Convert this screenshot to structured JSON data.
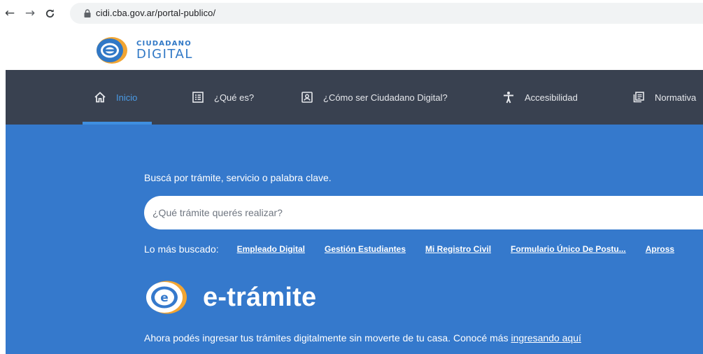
{
  "browser": {
    "url": "cidi.cba.gov.ar/portal-publico/"
  },
  "header": {
    "logo_top": "CIUDADANO",
    "logo_bottom": "DIGITAL"
  },
  "nav": {
    "items": [
      {
        "label": "Inicio",
        "icon": "home-icon",
        "active": true
      },
      {
        "label": "¿Qué es?",
        "icon": "list-doc-icon",
        "active": false
      },
      {
        "label": "¿Cómo ser Ciudadano Digital?",
        "icon": "id-card-icon",
        "active": false
      },
      {
        "label": "Accesibilidad",
        "icon": "accessibility-icon",
        "active": false
      },
      {
        "label": "Normativa",
        "icon": "documents-icon",
        "active": false
      }
    ]
  },
  "hero": {
    "prompt": "Buscá por trámite, servicio o palabra clave.",
    "search_placeholder": "¿Qué trámite querés realizar?",
    "popular_label": "Lo más buscado:",
    "popular_links": [
      "Empleado Digital",
      "Gestión Estudiantes",
      "Mi Registro Civil",
      "Formulario Único De Postu...",
      "Apross"
    ],
    "etramite_title": "e-trámite",
    "description": "Ahora podés ingresar tus trámites digitalmente sin moverte de tu casa. Conocé más ",
    "description_link": "ingresando aquí"
  },
  "colors": {
    "nav_bg": "#394150",
    "hero_bg": "#3579cc",
    "accent": "#3f8fe0",
    "logo_orange": "#f2a532"
  }
}
